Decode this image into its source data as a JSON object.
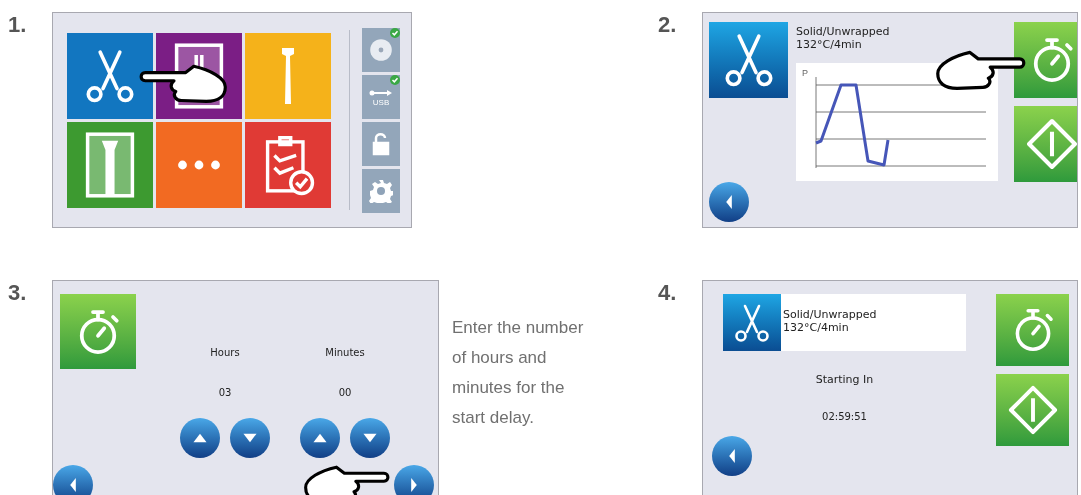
{
  "steps": [
    {
      "number": "1.",
      "kind": "menu",
      "tiles": [
        {
          "kind": "scissors",
          "color": "#1276c0"
        },
        {
          "kind": "wrapped",
          "color": "#7b1e85"
        },
        {
          "kind": "handpiece",
          "color": "#f5b21a"
        },
        {
          "kind": "wrapped_handpiece",
          "color": "#3d9a30"
        },
        {
          "kind": "more",
          "color": "#f26a22"
        },
        {
          "kind": "report",
          "color": "#e03a35"
        }
      ],
      "side_buttons": [
        {
          "kind": "disc",
          "checked": true
        },
        {
          "kind": "usb",
          "label": "USB",
          "checked": true
        },
        {
          "kind": "lock",
          "checked": false
        },
        {
          "kind": "gear",
          "checked": false
        }
      ]
    },
    {
      "number": "2.",
      "kind": "program",
      "title": "Solid/Unwrapped",
      "subtitle": "132°C/4min",
      "axis_label": "P"
    },
    {
      "number": "3.",
      "kind": "delay",
      "hours_label": "Hours",
      "hours_value": "03",
      "minutes_label": "Minutes",
      "minutes_value": "00",
      "caption": "Enter the number of hours and minutes for the start delay."
    },
    {
      "number": "4.",
      "kind": "countdown",
      "title": "Solid/Unwrapped",
      "subtitle": "132°C/4min",
      "status": "Starting In",
      "countdown": "02:59:51"
    }
  ]
}
